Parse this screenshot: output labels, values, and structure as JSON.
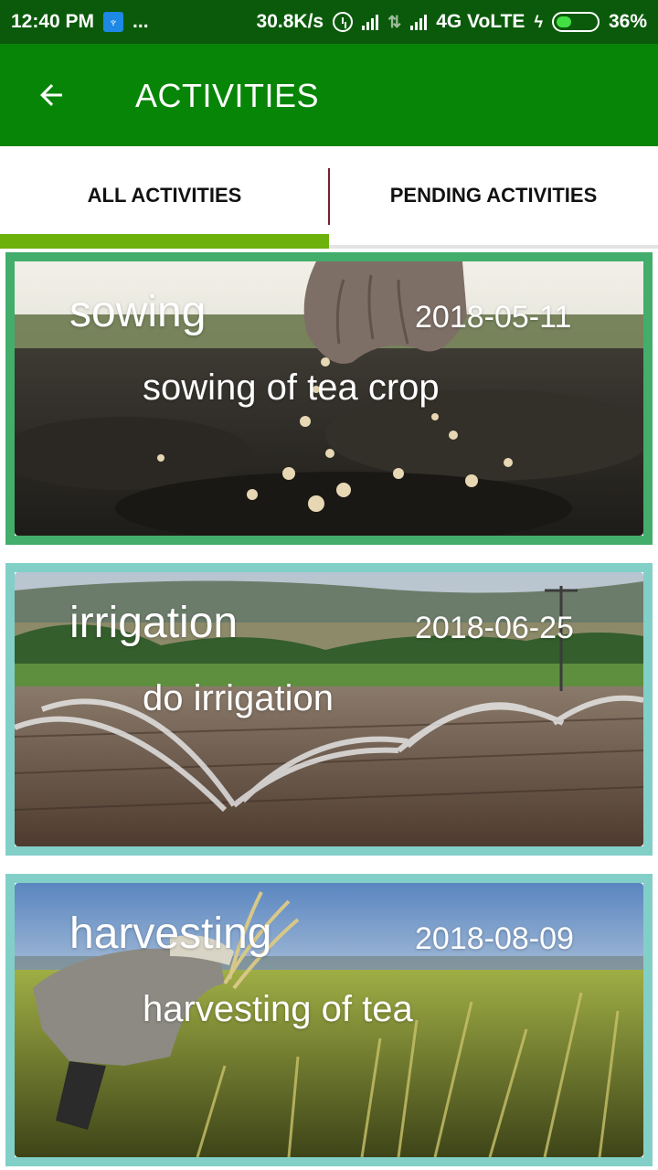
{
  "status_bar": {
    "time": "12:40 PM",
    "dots": "...",
    "speed": "30.8K/s",
    "network": "4G VoLTE",
    "battery": "36%",
    "battery_level": 0.36,
    "icons": [
      "app-notification-icon",
      "alarm-icon",
      "signal-icon",
      "data-arrows-icon",
      "signal-icon",
      "charging-icon",
      "battery-icon"
    ]
  },
  "toolbar": {
    "title": "ACTIVITIES",
    "back_icon": "arrow-left-icon",
    "color": "#078507"
  },
  "tabs": [
    {
      "label": "ALL ACTIVITIES",
      "selected": true
    },
    {
      "label": "PENDING ACTIVITIES",
      "selected": false
    }
  ],
  "accent": "#6cb10c",
  "activities": [
    {
      "title": "sowing",
      "date": "2018-05-11",
      "description": "sowing of tea crop",
      "image": "hand-sowing-seeds-soil"
    },
    {
      "title": "irrigation",
      "date": "2018-06-25",
      "description": "do irrigation",
      "image": "field-sprinklers"
    },
    {
      "title": "harvesting",
      "date": "2018-08-09",
      "description": "harvesting of tea",
      "image": "farmer-harvesting-grain"
    }
  ]
}
